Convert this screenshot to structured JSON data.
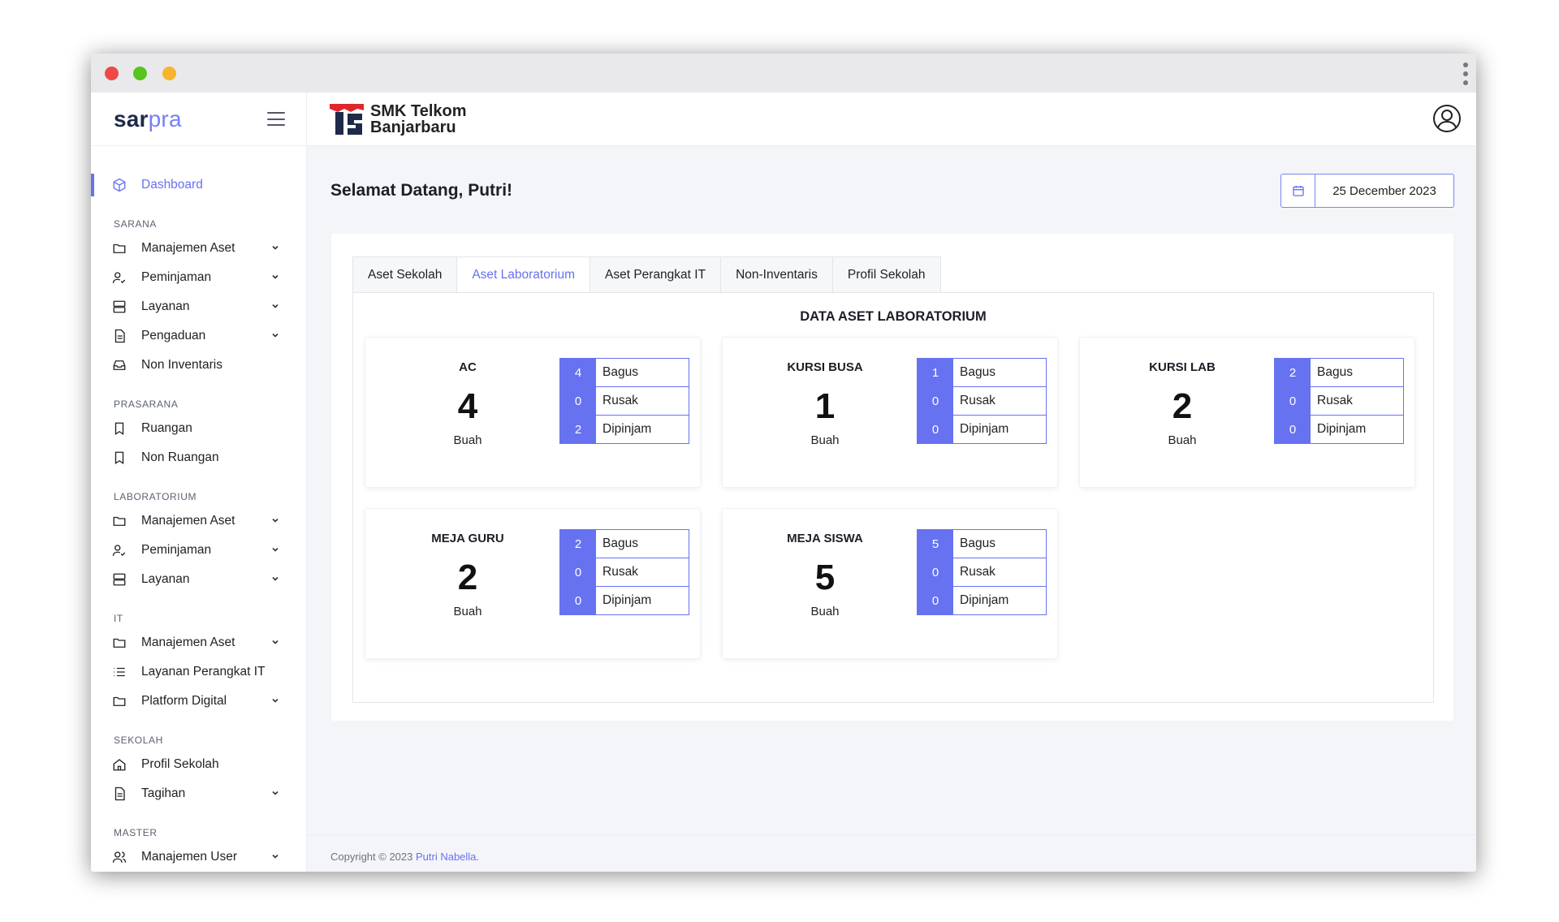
{
  "app": {
    "brand_part1": "sar",
    "brand_part2": "pra",
    "school_name_line1": "SMK Telkom",
    "school_name_line2": "Banjarbaru"
  },
  "sidebar": {
    "dashboard": "Dashboard",
    "sections": {
      "sarana": "SARANA",
      "prasarana": "PRASARANA",
      "laboratorium": "LABORATORIUM",
      "it": "IT",
      "sekolah": "SEKOLAH",
      "master": "MASTER"
    },
    "sarana_items": [
      "Manajemen Aset",
      "Peminjaman",
      "Layanan",
      "Pengaduan",
      "Non Inventaris"
    ],
    "prasarana_items": [
      "Ruangan",
      "Non Ruangan"
    ],
    "lab_items": [
      "Manajemen Aset",
      "Peminjaman",
      "Layanan"
    ],
    "it_items": [
      "Manajemen Aset",
      "Layanan Perangkat IT",
      "Platform Digital"
    ],
    "sekolah_items": [
      "Profil Sekolah",
      "Tagihan"
    ],
    "master_items": [
      "Manajemen User"
    ]
  },
  "header": {
    "welcome": "Selamat Datang, Putri!",
    "date": "25 December 2023"
  },
  "tabs": [
    "Aset Sekolah",
    "Aset Laboratorium",
    "Aset Perangkat IT",
    "Non-Inventaris",
    "Profil Sekolah"
  ],
  "active_tab": "Aset Laboratorium",
  "pane_title": "DATA ASET LABORATORIUM",
  "status_labels": {
    "good": "Bagus",
    "broken": "Rusak",
    "borrowed": "Dipinjam"
  },
  "unit": "Buah",
  "assets": [
    {
      "name": "AC",
      "total": "4",
      "good": "4",
      "broken": "0",
      "borrowed": "2"
    },
    {
      "name": "KURSI BUSA",
      "total": "1",
      "good": "1",
      "broken": "0",
      "borrowed": "0"
    },
    {
      "name": "KURSI LAB",
      "total": "2",
      "good": "2",
      "broken": "0",
      "borrowed": "0"
    },
    {
      "name": "MEJA GURU",
      "total": "2",
      "good": "2",
      "broken": "0",
      "borrowed": "0"
    },
    {
      "name": "MEJA SISWA",
      "total": "5",
      "good": "5",
      "broken": "0",
      "borrowed": "0"
    }
  ],
  "footer": {
    "prefix": "Copyright © 2023 ",
    "author": "Putri Nabella",
    "suffix": "."
  },
  "colors": {
    "accent": "#6672f0",
    "brand_red": "#e0262d",
    "brand_dark": "#1e2a4a"
  },
  "icons": {
    "user": "user-circle-icon",
    "calendar": "calendar-icon",
    "menu": "hamburger-icon"
  }
}
